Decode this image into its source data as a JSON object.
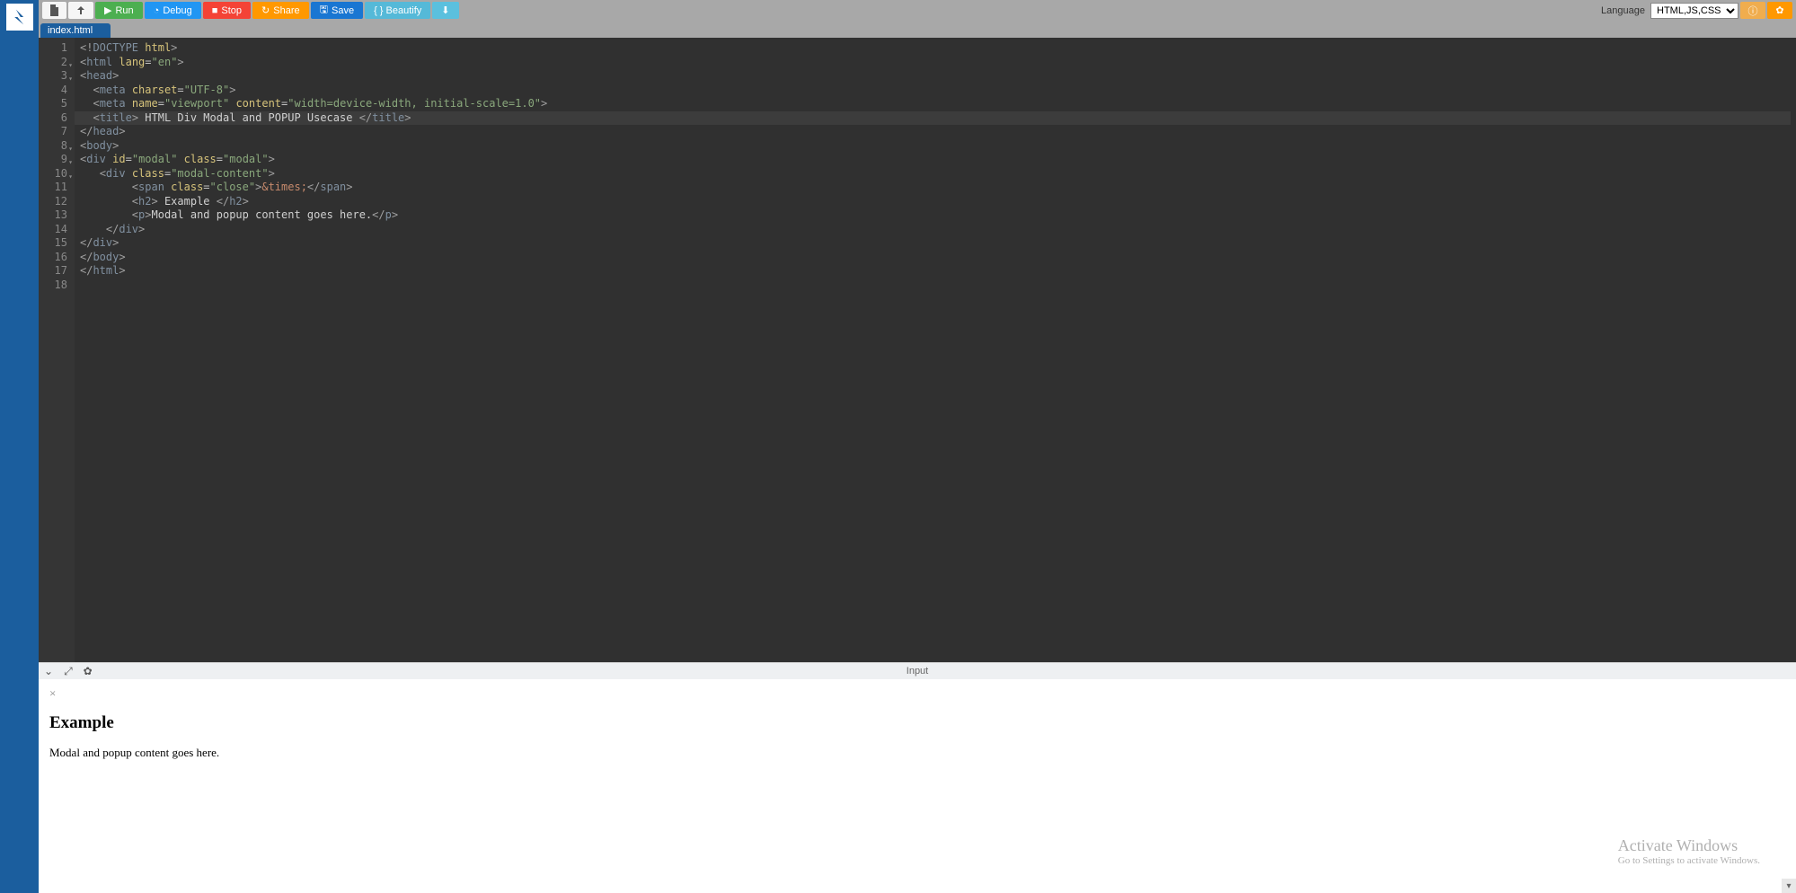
{
  "toolbar": {
    "run": "Run",
    "debug": "Debug",
    "stop": "Stop",
    "share": "Share",
    "save": "Save",
    "beautify": "{ } Beautify",
    "language_label": "Language",
    "language_value": "HTML,JS,CSS"
  },
  "tabs": {
    "active": "index.html"
  },
  "code_lines": [
    {
      "n": 1,
      "fold": false,
      "html": "<span class='t-brkt'>&lt;!</span><span class='t-tag'>DOCTYPE</span> <span class='t-attr'>html</span><span class='t-brkt'>&gt;</span>"
    },
    {
      "n": 2,
      "fold": true,
      "html": "<span class='t-brkt'>&lt;</span><span class='t-tag'>html</span> <span class='t-attr'>lang</span><span class='t-eq'>=</span><span class='t-str'>\"en\"</span><span class='t-brkt'>&gt;</span>"
    },
    {
      "n": 3,
      "fold": true,
      "html": "<span class='t-brkt'>&lt;</span><span class='t-tag'>head</span><span class='t-brkt'>&gt;</span>"
    },
    {
      "n": 4,
      "fold": false,
      "html": "  <span class='t-brkt'>&lt;</span><span class='t-tag'>meta</span> <span class='t-attr'>charset</span><span class='t-eq'>=</span><span class='t-str'>\"UTF-8\"</span><span class='t-brkt'>&gt;</span>"
    },
    {
      "n": 5,
      "fold": false,
      "html": "  <span class='t-brkt'>&lt;</span><span class='t-tag'>meta</span> <span class='t-attr'>name</span><span class='t-eq'>=</span><span class='t-str'>\"viewport\"</span> <span class='t-attr'>content</span><span class='t-eq'>=</span><span class='t-str'>\"width=device-width, initial-scale=1.0\"</span><span class='t-brkt'>&gt;</span>"
    },
    {
      "n": 6,
      "fold": false,
      "html": "  <span class='t-brkt'>&lt;</span><span class='t-tag'>title</span><span class='t-brkt'>&gt;</span><span class='t-txt'> HTML Div Modal and POPUP Usecase </span><span class='t-brkt'>&lt;/</span><span class='t-tag'>title</span><span class='t-brkt'>&gt;</span>",
      "hl": true
    },
    {
      "n": 7,
      "fold": false,
      "html": "<span class='t-brkt'>&lt;/</span><span class='t-tag'>head</span><span class='t-brkt'>&gt;</span>"
    },
    {
      "n": 8,
      "fold": true,
      "html": "<span class='t-brkt'>&lt;</span><span class='t-tag'>body</span><span class='t-brkt'>&gt;</span>"
    },
    {
      "n": 9,
      "fold": true,
      "html": "<span class='t-brkt'>&lt;</span><span class='t-tag'>div</span> <span class='t-attr'>id</span><span class='t-eq'>=</span><span class='t-str'>\"modal\"</span> <span class='t-attr'>class</span><span class='t-eq'>=</span><span class='t-str'>\"modal\"</span><span class='t-brkt'>&gt;</span>"
    },
    {
      "n": 10,
      "fold": true,
      "html": "   <span class='t-brkt'>&lt;</span><span class='t-tag'>div</span> <span class='t-attr'>class</span><span class='t-eq'>=</span><span class='t-str'>\"modal-content\"</span><span class='t-brkt'>&gt;</span>"
    },
    {
      "n": 11,
      "fold": false,
      "html": "        <span class='t-brkt'>&lt;</span><span class='t-tag'>span</span> <span class='t-attr'>class</span><span class='t-eq'>=</span><span class='t-str'>\"close\"</span><span class='t-brkt'>&gt;</span><span class='t-ent'>&amp;times;</span><span class='t-brkt'>&lt;/</span><span class='t-tag'>span</span><span class='t-brkt'>&gt;</span>"
    },
    {
      "n": 12,
      "fold": false,
      "html": "        <span class='t-brkt'>&lt;</span><span class='t-tag'>h2</span><span class='t-brkt'>&gt;</span><span class='t-txt'> Example </span><span class='t-brkt'>&lt;/</span><span class='t-tag'>h2</span><span class='t-brkt'>&gt;</span>"
    },
    {
      "n": 13,
      "fold": false,
      "html": "        <span class='t-brkt'>&lt;</span><span class='t-tag'>p</span><span class='t-brkt'>&gt;</span><span class='t-txt'>Modal and popup content goes here.</span><span class='t-brkt'>&lt;/</span><span class='t-tag'>p</span><span class='t-brkt'>&gt;</span>"
    },
    {
      "n": 14,
      "fold": false,
      "html": "    <span class='t-brkt'>&lt;/</span><span class='t-tag'>div</span><span class='t-brkt'>&gt;</span>"
    },
    {
      "n": 15,
      "fold": false,
      "html": "<span class='t-brkt'>&lt;/</span><span class='t-tag'>div</span><span class='t-brkt'>&gt;</span>"
    },
    {
      "n": 16,
      "fold": false,
      "html": "<span class='t-brkt'>&lt;/</span><span class='t-tag'>body</span><span class='t-brkt'>&gt;</span>"
    },
    {
      "n": 17,
      "fold": false,
      "html": "<span class='t-brkt'>&lt;/</span><span class='t-tag'>html</span><span class='t-brkt'>&gt;</span>"
    },
    {
      "n": 18,
      "fold": false,
      "html": ""
    }
  ],
  "output": {
    "label": "Input",
    "close_glyph": "×",
    "heading": "Example",
    "paragraph": "Modal and popup content goes here."
  },
  "watermark": {
    "title": "Activate Windows",
    "sub": "Go to Settings to activate Windows."
  }
}
